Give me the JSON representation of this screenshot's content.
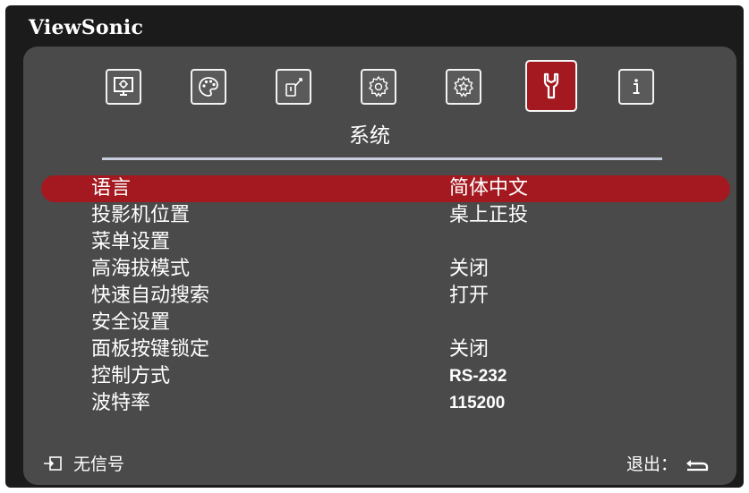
{
  "brand": "ViewSonic",
  "section_title": "系统",
  "tabs": [
    {
      "icon": "picture-icon",
      "active": false
    },
    {
      "icon": "color-palette-icon",
      "active": false
    },
    {
      "icon": "power-management-icon",
      "active": false
    },
    {
      "icon": "basic-settings-gear-icon",
      "active": false
    },
    {
      "icon": "advanced-settings-gear-icon",
      "active": false
    },
    {
      "icon": "system-wrench-icon",
      "active": true
    },
    {
      "icon": "information-icon",
      "active": false
    }
  ],
  "menu": [
    {
      "label": "语言",
      "value": "简体中文",
      "selected": true
    },
    {
      "label": "投影机位置",
      "value": "桌上正投",
      "selected": false
    },
    {
      "label": "菜单设置",
      "value": "",
      "selected": false
    },
    {
      "label": "高海拔模式",
      "value": "关闭",
      "selected": false
    },
    {
      "label": "快速自动搜索",
      "value": "打开",
      "selected": false
    },
    {
      "label": "安全设置",
      "value": "",
      "selected": false
    },
    {
      "label": "面板按键锁定",
      "value": "关闭",
      "selected": false
    },
    {
      "label": "控制方式",
      "value": "RS-232",
      "selected": false
    },
    {
      "label": "波特率",
      "value": "115200",
      "selected": false
    }
  ],
  "footer": {
    "input_status": "无信号",
    "exit_label": "退出："
  },
  "colors": {
    "frame": "#1b1b1b",
    "panel": "#4a4a4a",
    "accent": "#a4191f",
    "divider": "#c9cde0",
    "text": "#ffffff"
  }
}
